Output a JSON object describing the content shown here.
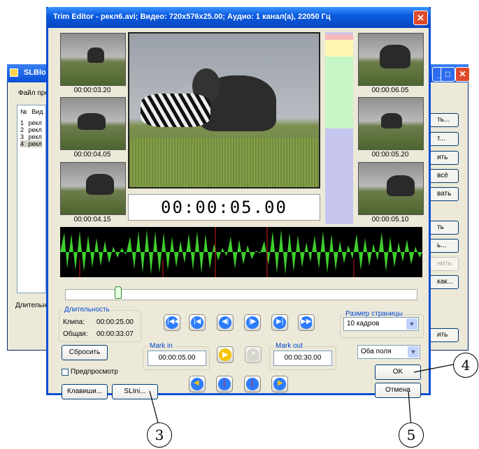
{
  "background_window": {
    "title": "SLBlock",
    "file_label": "Файл прое",
    "list_header": [
      "№",
      "Вид"
    ],
    "rows": [
      {
        "n": "1",
        "t": "рекл"
      },
      {
        "n": "2",
        "t": "рекл"
      },
      {
        "n": "3",
        "t": "рекл"
      },
      {
        "n": "4",
        "t": "рекл"
      }
    ],
    "duration_label": "Длительно",
    "buttons": [
      "ть...",
      "т...",
      "ить",
      "всё",
      "вать",
      "ть",
      "ь...",
      "нить",
      "как...",
      "ить"
    ]
  },
  "window": {
    "title": "Trim Editor - рекл6.avi; Видео: 720x576x25.00; Аудио: 1 канал(а), 22050 Гц",
    "close": "✕"
  },
  "thumbnails": {
    "left": [
      "00:00:03.20",
      "00:00:04.05",
      "00:00:04.15"
    ],
    "right": [
      "00:00:06.05",
      "00:00:05.20",
      "00:00:05.10"
    ]
  },
  "timecode": "00:00:05.00",
  "duration": {
    "label": "Длительность",
    "clip_label": "Клипа:",
    "clip_value": "00:00:25.00",
    "total_label": "Общая:",
    "total_value": "00:00:33.07"
  },
  "page_size": {
    "label": "Размер страницы",
    "value": "10 кадров"
  },
  "reset_button": "Сбросить",
  "mark_in": {
    "label": "Mark in",
    "value": "00:00:05.00"
  },
  "mark_out": {
    "label": "Mark out",
    "value": "00:00:30.00"
  },
  "fields_select": "Оба поля",
  "preview_checkbox": "Предпросмотр",
  "keys_button": "Клавиши...",
  "slini_button": "SLIni...",
  "ok_button": "OK",
  "cancel_button": "Отмена",
  "callouts": {
    "c3": "3",
    "c4": "4",
    "c5": "5"
  },
  "colors": {
    "title_blue": "#0a5be0",
    "nav_blue": "#2b7bff",
    "play_yellow": "#f5c400",
    "waveform_green": "#3ecf2e",
    "close_red": "#e04a2c"
  }
}
